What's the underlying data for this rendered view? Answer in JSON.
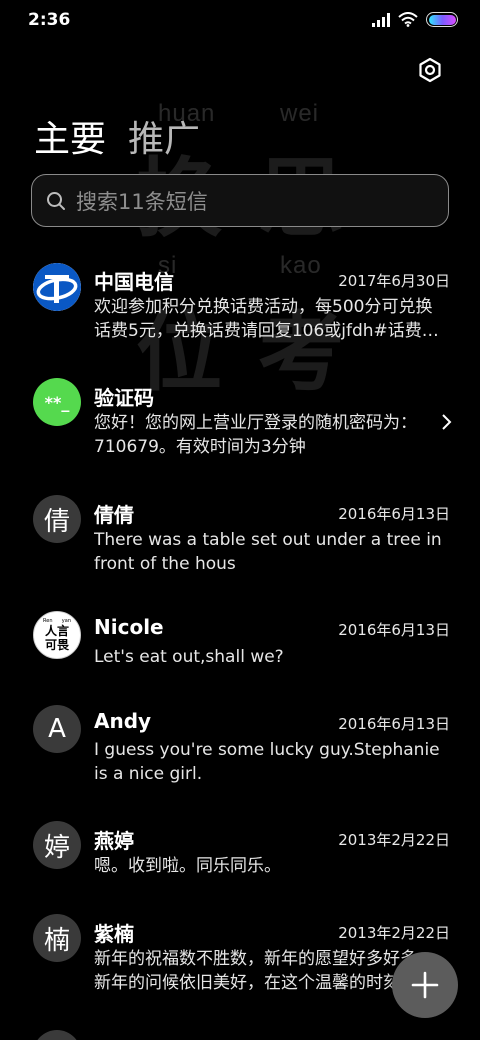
{
  "status_bar": {
    "time": "2:36",
    "icons": [
      "signal-icon",
      "wifi-icon",
      "battery-icon"
    ],
    "battery_colors": [
      "#2ee7ff",
      "#7a5cff",
      "#d94dff"
    ]
  },
  "watermark": {
    "pinyin": [
      "huan",
      "wei",
      "si",
      "kao"
    ],
    "chars": [
      "换",
      "思",
      "位",
      "考"
    ]
  },
  "header": {
    "settings_icon": "gear-icon",
    "tabs": [
      {
        "label": "主要",
        "active": true
      },
      {
        "label": "推广",
        "active": false
      }
    ]
  },
  "search": {
    "placeholder": "搜索11条短信",
    "icon": "search-icon"
  },
  "conversations": [
    {
      "name": "中国电信",
      "date": "2017年6月30日",
      "preview": "欢迎参加积分兑换话费活动，每500分可兑换话费5元，兑换话费请回复106或jfdh#话费…",
      "avatar": {
        "type": "logo",
        "icon": "china-telecom-logo",
        "color": "#0a58c4"
      }
    },
    {
      "name": "验证码",
      "date": "",
      "preview": "您好！您的网上营业厅登录的随机密码为：710679。有效时间为3分钟",
      "avatar": {
        "type": "text",
        "text": "**_",
        "color": "#55d94e"
      },
      "chevron": "chevron-right-icon"
    },
    {
      "name": "倩倩",
      "date": "2016年6月13日",
      "preview": "There was a table set out under a tree in front of the hous",
      "avatar": {
        "type": "letter",
        "text": "倩"
      }
    },
    {
      "name": "Nicole",
      "date": "2016年6月13日",
      "preview": "Let's eat out,shall we?",
      "avatar": {
        "type": "image",
        "top_left": "Ren",
        "top_right": "yan",
        "line1": "人言",
        "line2": "可畏"
      }
    },
    {
      "name": "Andy",
      "date": "2016年6月13日",
      "preview": "I guess you're some lucky guy.Stephanie is a nice girl.",
      "avatar": {
        "type": "letter",
        "text": "A"
      }
    },
    {
      "name": "燕婷",
      "date": "2013年2月22日",
      "preview": "嗯。收到啦。同乐同乐。",
      "avatar": {
        "type": "letter",
        "text": "婷"
      }
    },
    {
      "name": "紫楠",
      "date": "2013年2月22日",
      "preview": "新年的祝福数不胜数，新年的愿望好多好多，新年的问候依旧美好，在这个温馨的时刻",
      "avatar": {
        "type": "letter",
        "text": "楠"
      }
    }
  ],
  "fab": {
    "icon": "plus-icon"
  }
}
